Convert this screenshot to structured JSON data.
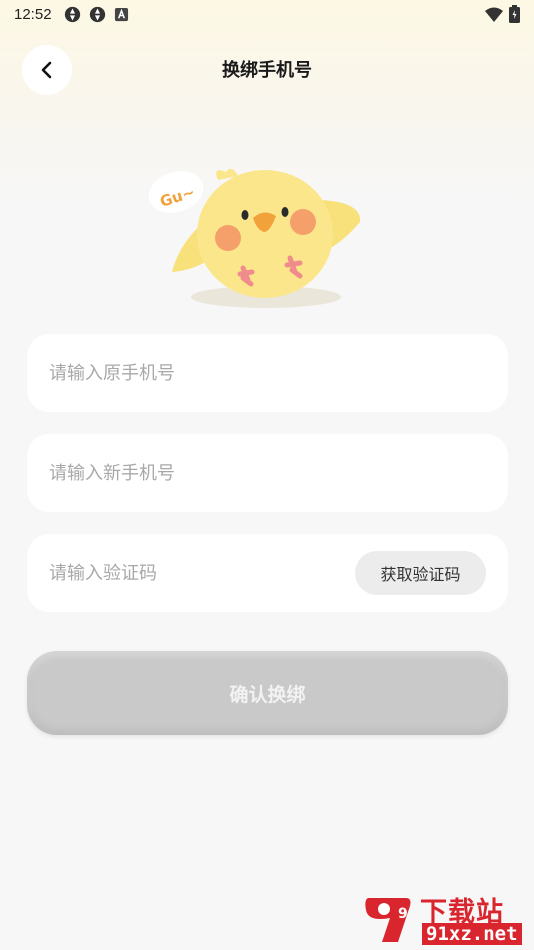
{
  "status_bar": {
    "time": "12:52",
    "left_icons": [
      "sync-icon",
      "sync-icon",
      "a-notification-icon"
    ],
    "right_icons": [
      "wifi-icon",
      "battery-icon"
    ]
  },
  "header": {
    "back_icon": "chevron-left-icon",
    "title": "换绑手机号"
  },
  "mascot": {
    "speech_text": "Gu~",
    "colors": {
      "body": "#fbe68c",
      "cheek": "#f5a06a",
      "beak": "#f2a23b"
    }
  },
  "form": {
    "old_phone": {
      "placeholder": "请输入原手机号",
      "value": ""
    },
    "new_phone": {
      "placeholder": "请输入新手机号",
      "value": ""
    },
    "code": {
      "placeholder": "请输入验证码",
      "value": "",
      "button_label": "获取验证码"
    }
  },
  "confirm_button": {
    "label": "确认换绑"
  },
  "watermark": {
    "logo_text": "9",
    "top": "下载站",
    "bottom": "91xz.net"
  },
  "colors": {
    "background": "#f7f7f7",
    "card": "#ffffff",
    "button_disabled": "#c9c9c9",
    "code_button": "#ececec",
    "watermark_red": "#d9262e"
  }
}
